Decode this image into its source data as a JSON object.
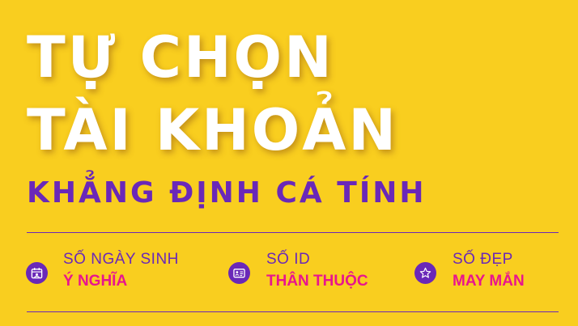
{
  "headline": {
    "line1": "TỰ CHỌN",
    "line2": "TÀI KHOẢN"
  },
  "subheadline": "KHẲNG ĐỊNH CÁ TÍNH",
  "features": [
    {
      "icon": "calendar-icon",
      "label": "SỐ NGÀY SINH",
      "highlight": "Ý NGHĨA"
    },
    {
      "icon": "id-card-icon",
      "label": "SỐ ID",
      "highlight": "THÂN THUỘC"
    },
    {
      "icon": "star-icon",
      "label": "SỐ ĐẸP",
      "highlight": "MAY MẮN"
    }
  ],
  "colors": {
    "background": "#F9CE1F",
    "headline": "#FFFFFF",
    "accent_purple": "#6A28B8",
    "highlight_pink": "#E8158E"
  }
}
